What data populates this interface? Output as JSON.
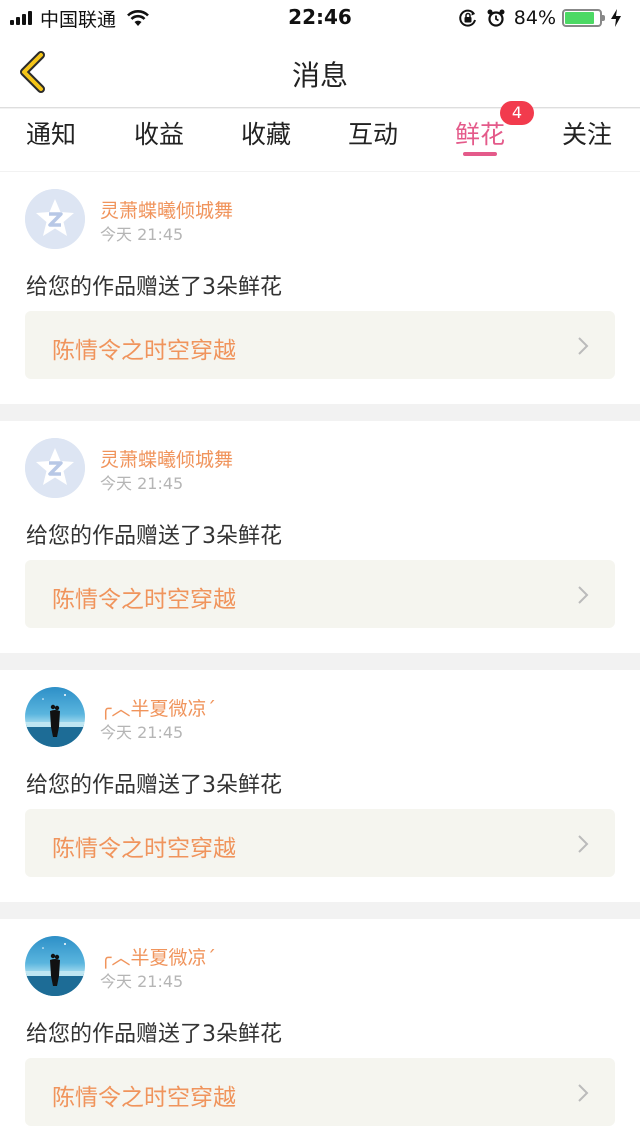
{
  "status_bar": {
    "carrier": "中国联通",
    "time": "22:46",
    "battery_percent": "84%",
    "battery_level": 0.84,
    "icons": [
      "signal-icon",
      "wifi-icon",
      "orientation-lock-icon",
      "alarm-icon",
      "battery-icon",
      "charging-icon"
    ]
  },
  "header": {
    "title": "消息",
    "back_icon": "chevron-left-icon",
    "accent": "#f5c518"
  },
  "tabs": {
    "items": [
      {
        "label": "通知"
      },
      {
        "label": "收益"
      },
      {
        "label": "收藏"
      },
      {
        "label": "互动"
      },
      {
        "label": "鲜花",
        "active": true,
        "badge": "4"
      },
      {
        "label": "关注"
      }
    ],
    "active_color": "#e45a8a",
    "badge_color": "#f23b4d"
  },
  "messages": [
    {
      "username": "灵萧蝶曦倾城舞",
      "time": "今天 21:45",
      "text": "给您的作品赠送了3朵鲜花",
      "work_title": "陈情令之时空穿越",
      "avatar": "default-avatar"
    },
    {
      "username": "灵萧蝶曦倾城舞",
      "time": "今天 21:45",
      "text": "给您的作品赠送了3朵鲜花",
      "work_title": "陈情令之时空穿越",
      "avatar": "default-avatar"
    },
    {
      "username": "╭︿半夏微凉ˊ",
      "time": "今天 21:45",
      "text": "给您的作品赠送了3朵鲜花",
      "work_title": "陈情令之时空穿越",
      "avatar": "photo-avatar"
    },
    {
      "username": "╭︿半夏微凉ˊ",
      "time": "今天 21:45",
      "text": "给您的作品赠送了3朵鲜花",
      "work_title": "陈情令之时空穿越",
      "avatar": "photo-avatar"
    }
  ],
  "colors": {
    "username": "#f0945c",
    "work_title": "#f0945c",
    "timestamp": "#b5b5b5"
  }
}
